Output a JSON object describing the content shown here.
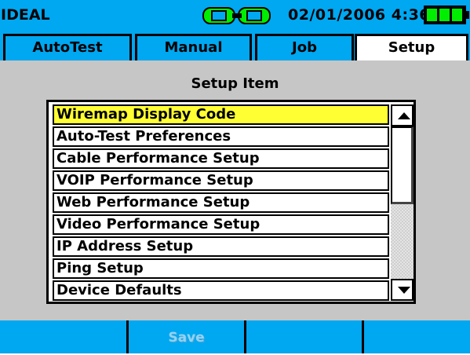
{
  "status_bar": {
    "brand": "IDEAL",
    "link_icon": "link-connected-icon",
    "datetime": "02/01/2006 4:36",
    "battery_icon": "battery-full-icon",
    "colors": {
      "bar": "#00a7f1",
      "battery_fill": "#00ee00",
      "link": "#00ee00"
    }
  },
  "tabs": [
    {
      "label": "AutoTest",
      "active": false
    },
    {
      "label": "Manual",
      "active": false
    },
    {
      "label": "Job",
      "active": false
    },
    {
      "label": "Setup",
      "active": true
    }
  ],
  "main": {
    "title": "Setup Item",
    "items": [
      {
        "label": "Wiremap Display Code",
        "selected": true
      },
      {
        "label": "Auto-Test Preferences",
        "selected": false
      },
      {
        "label": "Cable Performance Setup",
        "selected": false
      },
      {
        "label": "VOIP Performance Setup",
        "selected": false
      },
      {
        "label": "Web Performance Setup",
        "selected": false
      },
      {
        "label": "Video Performance Setup",
        "selected": false
      },
      {
        "label": "IP Address Setup",
        "selected": false
      },
      {
        "label": "Ping Setup",
        "selected": false
      },
      {
        "label": "Device Defaults",
        "selected": false
      }
    ],
    "selection_color": "#ffff33"
  },
  "softkeys": [
    {
      "label": "",
      "enabled": false
    },
    {
      "label": "Save",
      "enabled": false
    },
    {
      "label": "",
      "enabled": false
    },
    {
      "label": "",
      "enabled": false
    }
  ]
}
